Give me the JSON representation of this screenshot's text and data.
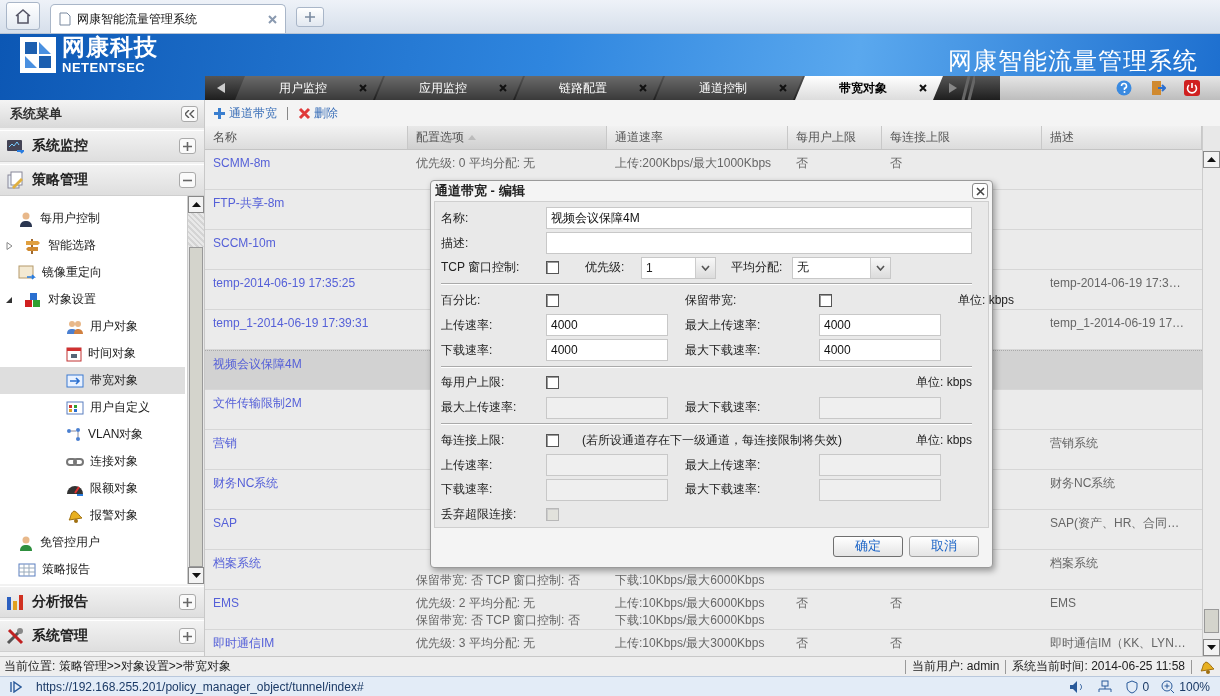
{
  "browser": {
    "tab_title": "网康智能流量管理系统",
    "url": "https://192.168.255.201/policy_manager_object/tunnel/index#",
    "blocked_count": "0",
    "zoom": "100%"
  },
  "header": {
    "logo_name": "网康科技",
    "logo_latin": "NETENTSEC",
    "title": "网康智能流量管理系统"
  },
  "nav_tabs": [
    {
      "label": "用户监控",
      "selected": false
    },
    {
      "label": "应用监控",
      "selected": false
    },
    {
      "label": "链路配置",
      "selected": false
    },
    {
      "label": "通道控制",
      "selected": false
    },
    {
      "label": "带宽对象",
      "selected": true
    }
  ],
  "sidebar": {
    "title": "系统菜单",
    "sections": [
      {
        "label": "系统监控",
        "expanded": false
      },
      {
        "label": "策略管理",
        "expanded": true,
        "items": [
          {
            "label": "每用户控制",
            "selected": false
          },
          {
            "label": "智能选路",
            "selected": false,
            "expanded": false
          },
          {
            "label": "镜像重定向",
            "selected": false
          },
          {
            "label": "对象设置",
            "selected": false,
            "expanded": true,
            "children": [
              {
                "label": "用户对象",
                "selected": false
              },
              {
                "label": "时间对象",
                "selected": false
              },
              {
                "label": "带宽对象",
                "selected": true
              },
              {
                "label": "用户自定义",
                "selected": false
              },
              {
                "label": "VLAN对象",
                "selected": false
              },
              {
                "label": "连接对象",
                "selected": false
              },
              {
                "label": "限额对象",
                "selected": false
              },
              {
                "label": "报警对象",
                "selected": false
              }
            ]
          },
          {
            "label": "免管控用户",
            "selected": false
          },
          {
            "label": "策略报告",
            "selected": false
          }
        ]
      },
      {
        "label": "分析报告",
        "expanded": false
      },
      {
        "label": "系统管理",
        "expanded": false
      }
    ]
  },
  "toolbar": {
    "buttons": [
      {
        "kind": "add",
        "label": "通道带宽"
      },
      {
        "kind": "delete",
        "label": "删除"
      }
    ]
  },
  "table": {
    "columns": [
      {
        "label": "名称",
        "sorted": false
      },
      {
        "label": "配置选项",
        "sorted": true
      },
      {
        "label": "通道速率",
        "sorted": false
      },
      {
        "label": "每用户上限",
        "sorted": false
      },
      {
        "label": "每连接上限",
        "sorted": false
      },
      {
        "label": "描述",
        "sorted": false
      }
    ],
    "rows": [
      {
        "name": "SCMM-8m",
        "selected": false,
        "config": {
          "line_1": "优先级: 0  平均分配: 无"
        },
        "rate": {
          "line_1": "上传:200Kbps/最大1000Kbps"
        },
        "per_user": "否",
        "per_connection": "否"
      },
      {
        "name": "FTP-共享-8m",
        "selected": false
      },
      {
        "name": "SCCM-10m",
        "selected": false
      },
      {
        "name": "temp-2014-06-19 17:35:25",
        "selected": false,
        "description": "temp-2014-06-19 17:3…"
      },
      {
        "name": "temp_1-2014-06-19 17:39:31",
        "selected": false,
        "description": "temp_1-2014-06-19 17…"
      },
      {
        "name": "视频会议保障4M",
        "selected": true
      },
      {
        "name": "文件传输限制2M",
        "selected": false
      },
      {
        "name": "营销",
        "selected": false,
        "description": "营销系统"
      },
      {
        "name": "财务NC系统",
        "selected": false,
        "description": "财务NC系统"
      },
      {
        "name": "SAP",
        "selected": false,
        "description": "SAP(资产、HR、合同…"
      },
      {
        "name": "档案系统",
        "selected": false,
        "config": {
          "line_2": "保留带宽: 否  TCP 窗口控制: 否"
        },
        "rate": {
          "line_2": "下载:10Kbps/最大6000Kbps"
        },
        "description": "档案系统"
      },
      {
        "name": "EMS",
        "selected": false,
        "config": {
          "line_1": "优先级: 2  平均分配: 无",
          "line_2": "保留带宽: 否  TCP 窗口控制: 否"
        },
        "rate": {
          "line_1": "上传:10Kbps/最大6000Kbps",
          "line_2": "下载:10Kbps/最大6000Kbps"
        },
        "per_user": "否",
        "per_connection": "否",
        "description": "EMS"
      },
      {
        "name": "即时通信IM",
        "selected": false,
        "config": {
          "line_1": "优先级: 3  平均分配: 无"
        },
        "rate": {
          "line_1": "上传:10Kbps/最大3000Kbps"
        },
        "per_user": "否",
        "per_connection": "否",
        "description": "即时通信IM（KK、LYN…"
      }
    ]
  },
  "dialog": {
    "title": "通道带宽 - 编辑",
    "name": {
      "label": "名称:",
      "value": "视频会议保障4M"
    },
    "description": {
      "label": "描述:"
    },
    "tcp_window": {
      "label": "TCP 窗口控制:",
      "checked": false
    },
    "priority": {
      "label": "优先级:",
      "value": "1"
    },
    "average": {
      "label": "平均分配:",
      "value": "无"
    },
    "sections": [
      {
        "unit": "单位: kbps",
        "rows": [
          [
            {
              "kind": "check",
              "label": "百分比:",
              "checked": false,
              "disabled": false
            },
            {
              "kind": "check",
              "label": "保留带宽:",
              "checked": false,
              "disabled": false
            }
          ],
          [
            {
              "kind": "input",
              "label": "上传速率:",
              "value": "4000",
              "disabled": false
            },
            {
              "kind": "input",
              "label": "最大上传速率:",
              "value": "4000",
              "disabled": false
            }
          ],
          [
            {
              "kind": "input",
              "label": "下载速率:",
              "value": "4000",
              "disabled": false
            },
            {
              "kind": "input",
              "label": "最大下载速率:",
              "value": "4000",
              "disabled": false
            }
          ]
        ]
      },
      {
        "unit": "单位: kbps",
        "rows": [
          [
            {
              "kind": "check",
              "label": "每用户上限:",
              "checked": false,
              "disabled": false
            }
          ],
          [
            {
              "kind": "input",
              "label": "最大上传速率:",
              "disabled": true
            },
            {
              "kind": "input",
              "label": "最大下载速率:",
              "disabled": true
            }
          ]
        ]
      },
      {
        "unit": "单位: kbps",
        "rows": [
          [
            {
              "kind": "check",
              "label": "每连接上限:",
              "checked": false,
              "disabled": false,
              "note": "(若所设通道存在下一级通道，每连接限制将失效)"
            }
          ],
          [
            {
              "kind": "input",
              "label": "上传速率:",
              "disabled": true
            },
            {
              "kind": "input",
              "label": "最大上传速率:",
              "disabled": true
            }
          ],
          [
            {
              "kind": "input",
              "label": "下载速率:",
              "disabled": true
            },
            {
              "kind": "input",
              "label": "最大下载速率:",
              "disabled": true
            }
          ],
          [
            {
              "kind": "check",
              "label": "丢弃超限连接:",
              "checked": false,
              "disabled": true
            }
          ]
        ]
      }
    ],
    "buttons": [
      {
        "kind": "ok",
        "label": "确定"
      },
      {
        "kind": "cancel",
        "label": "取消"
      }
    ]
  },
  "status": {
    "location": "当前位置: 策略管理>>对象设置>>带宽对象",
    "user": "当前用户: admin",
    "time": "系统当前时间: 2014-06-25 11:58"
  }
}
